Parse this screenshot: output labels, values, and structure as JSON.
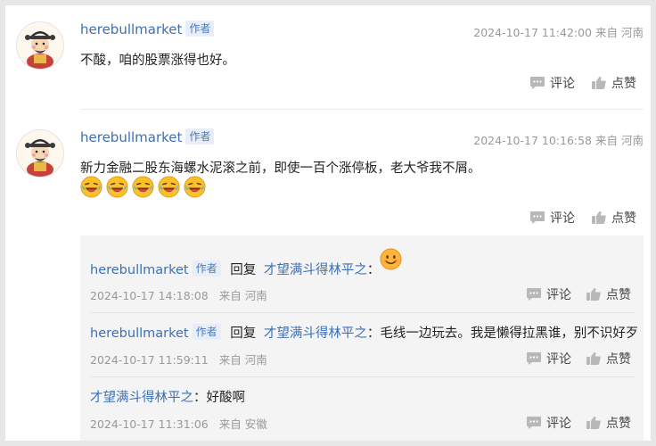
{
  "comments": [
    {
      "username": "herebullmarket",
      "badge": "作者",
      "datetime": "2024-10-17 11:42:00",
      "location": "来自 河南",
      "text": "不酸，咱的股票涨得也好。",
      "comment_label": "评论",
      "like_label": "点赞"
    },
    {
      "username": "herebullmarket",
      "badge": "作者",
      "datetime": "2024-10-17 10:16:58",
      "location": "来自 河南",
      "text": "新力金融二股东海螺水泥滚之前，即使一百个涨停板，老大爷我不屑。",
      "emojis": [
        "laugh-emoji",
        "laugh-emoji",
        "laugh-emoji",
        "laugh-emoji",
        "laugh-emoji"
      ],
      "comment_label": "评论",
      "like_label": "点赞"
    }
  ],
  "replies": [
    {
      "username": "herebullmarket",
      "badge": "作者",
      "reply_word": "回复",
      "target": "才望满斗得林平之",
      "separator": "：",
      "text": "",
      "emoji": "smile-emoji",
      "date": "2024-10-17 14:18:08",
      "location": "来自 河南",
      "comment_label": "评论",
      "like_label": "点赞"
    },
    {
      "username": "herebullmarket",
      "badge": "作者",
      "reply_word": "回复",
      "target": "才望满斗得林平之",
      "separator": "：",
      "text": "毛线一边玩去。我是懒得拉黑谁，别不识好歹",
      "date": "2024-10-17 11:59:11",
      "location": "来自 河南",
      "comment_label": "评论",
      "like_label": "点赞"
    },
    {
      "username": "才望满斗得林平之",
      "separator": "：",
      "text": "好酸啊",
      "date": "2024-10-17 11:31:06",
      "location": "来自 安徽",
      "comment_label": "评论",
      "like_label": "点赞"
    }
  ],
  "colors": {
    "link": "#3d6fb6",
    "badge_bg": "#e8eef8",
    "meta": "#999999",
    "reply_bg": "#f4f4f4"
  }
}
